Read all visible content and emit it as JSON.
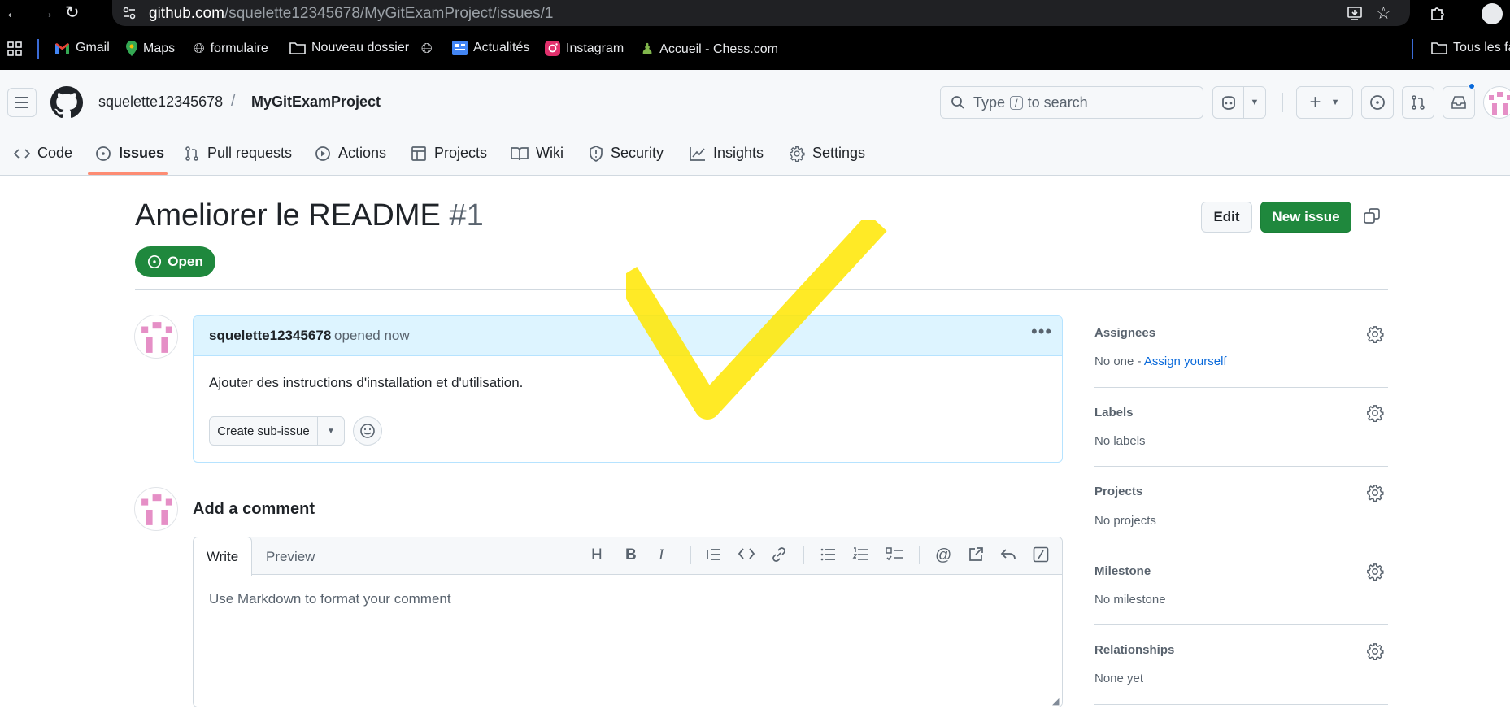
{
  "browser": {
    "url_host": "github.com",
    "url_path": "/squelette12345678/MyGitExamProject/issues/1",
    "bookmarks": [
      {
        "label": "Gmail",
        "icon": "gmail-icon"
      },
      {
        "label": "Maps",
        "icon": "maps-icon"
      },
      {
        "label": "formulaire",
        "icon": "globe-icon"
      },
      {
        "label": "Nouveau dossier",
        "icon": "folder-icon"
      },
      {
        "label": "",
        "icon": "globe-icon"
      },
      {
        "label": "Actualités",
        "icon": "news-icon"
      },
      {
        "label": "Instagram",
        "icon": "instagram-icon"
      },
      {
        "label": "Accueil - Chess.com",
        "icon": "chess-icon"
      }
    ],
    "all_bookmarks_label": "Tous les fa"
  },
  "header": {
    "owner": "squelette12345678",
    "separator": "/",
    "repo": "MyGitExamProject",
    "search_prefix": "Type",
    "search_key": "/",
    "search_suffix": "to search"
  },
  "tabs": [
    {
      "label": "Code",
      "icon": "code-icon"
    },
    {
      "label": "Issues",
      "icon": "issue-opened-icon",
      "selected": true
    },
    {
      "label": "Pull requests",
      "icon": "git-pull-request-icon"
    },
    {
      "label": "Actions",
      "icon": "play-icon"
    },
    {
      "label": "Projects",
      "icon": "table-icon"
    },
    {
      "label": "Wiki",
      "icon": "book-icon"
    },
    {
      "label": "Security",
      "icon": "shield-icon"
    },
    {
      "label": "Insights",
      "icon": "graph-icon"
    },
    {
      "label": "Settings",
      "icon": "gear-icon"
    }
  ],
  "issue": {
    "title": "Ameliorer le README",
    "number": "#1",
    "state": "Open",
    "edit_label": "Edit",
    "new_issue_label": "New issue",
    "author": "squelette12345678",
    "opened_text": "opened now",
    "body": "Ajouter des instructions d'installation et d'utilisation.",
    "create_sub_issue_label": "Create sub-issue"
  },
  "comment": {
    "heading": "Add a comment",
    "write_tab": "Write",
    "preview_tab": "Preview",
    "placeholder": "Use Markdown to format your comment",
    "toolbar_icons": [
      "heading-icon",
      "bold-icon",
      "italic-icon",
      "quote-icon",
      "code-icon",
      "link-icon",
      "bullet-list-icon",
      "numbered-list-icon",
      "task-list-icon",
      "mention-icon",
      "cross-reference-icon",
      "reply-icon",
      "slash-command-icon"
    ]
  },
  "sidebar": [
    {
      "title": "Assignees",
      "value": "No one - ",
      "link": "Assign yourself"
    },
    {
      "title": "Labels",
      "value": "No labels"
    },
    {
      "title": "Projects",
      "value": "No projects"
    },
    {
      "title": "Milestone",
      "value": "No milestone"
    },
    {
      "title": "Relationships",
      "value": "None yet"
    }
  ],
  "colors": {
    "accent_green": "#1f883d",
    "link_blue": "#0969da",
    "selected_tab_underline": "#fd8c73",
    "comment_header_bg": "#ddf4ff",
    "highlight_check": "#ffe600"
  }
}
